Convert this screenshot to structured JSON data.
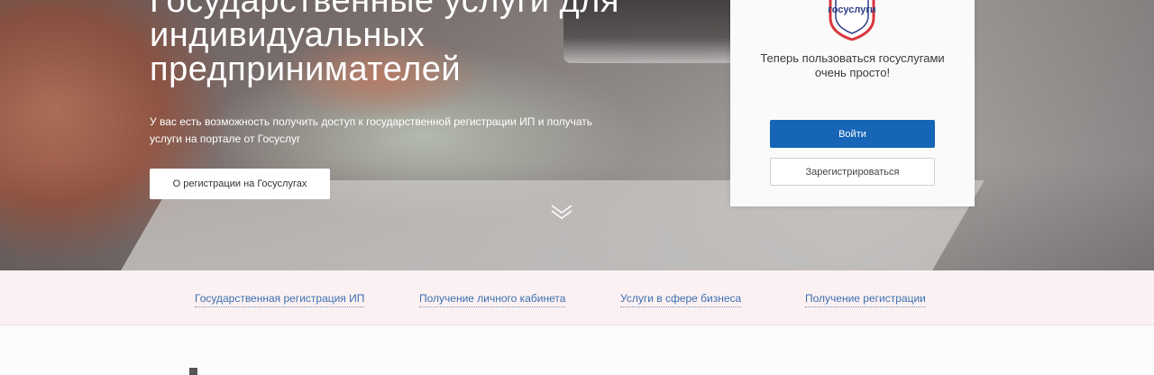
{
  "hero": {
    "title_line1": "Государственные услуги для",
    "title_line2": "индивидуальных",
    "title_line3": "предпринимателей",
    "description": "У вас есть возможность получить доступ к государственной регистрации ИП и получать услуги на портале от Госуслуг",
    "cta_label": "О регистрации на Госуслугах"
  },
  "login_card": {
    "logo_text": "госуслуги",
    "message": "Теперь пользоваться госуслугами очень просто!",
    "login_button": "Войти",
    "register_button": "Зарегистрироваться"
  },
  "subnav": {
    "items": [
      {
        "label": "Государственная регистрация ИП"
      },
      {
        "label": "Получение личного кабинета"
      },
      {
        "label": "Услуги в сфере бизнеса"
      },
      {
        "label": "Получение регистрации"
      }
    ]
  },
  "colors": {
    "primary_button": "#1665b6",
    "link": "#3a6fb0",
    "subnav_background": "#fcf1f2"
  }
}
